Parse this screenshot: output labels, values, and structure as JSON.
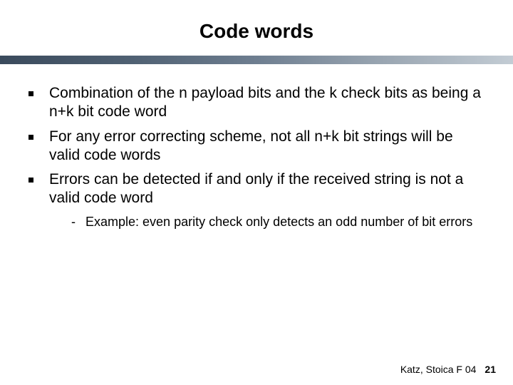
{
  "title": "Code words",
  "bullets": [
    {
      "text": "Combination of the n payload bits and the k check bits as being a n+k bit code word"
    },
    {
      "text": "For any error correcting scheme, not all n+k bit strings will be valid code words"
    },
    {
      "text": "Errors can be detected if and only if the received string is not a valid code word"
    }
  ],
  "sub_bullets": [
    {
      "marker": "-",
      "text": "Example: even parity check only detects an odd number of bit errors"
    }
  ],
  "footer": {
    "credit": "Katz, Stoica F 04",
    "page": "21"
  }
}
